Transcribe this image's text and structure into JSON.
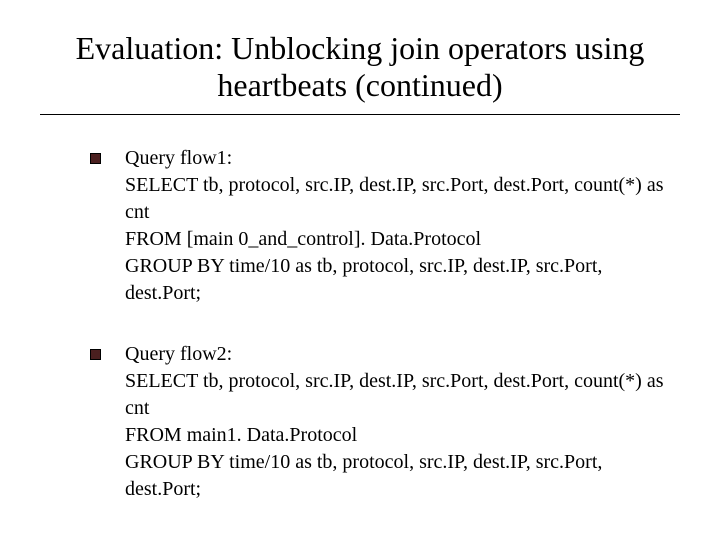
{
  "title": "Evaluation: Unblocking join operators using heartbeats (continued)",
  "items": [
    {
      "bullet_icon": "square",
      "lines": [
        "Query flow1:",
        "SELECT tb, protocol, src.IP, dest.IP, src.Port, dest.Port, count(*) as cnt",
        "FROM [main 0_and_control]. Data.Protocol",
        "GROUP BY time/10 as tb, protocol, src.IP, dest.IP, src.Port, dest.Port;"
      ]
    },
    {
      "bullet_icon": "square",
      "lines": [
        "Query flow2:",
        "SELECT tb, protocol, src.IP, dest.IP, src.Port, dest.Port, count(*) as cnt",
        "FROM main1. Data.Protocol",
        "GROUP BY time/10 as tb, protocol, src.IP, dest.IP, src.Port, dest.Port;"
      ]
    }
  ]
}
